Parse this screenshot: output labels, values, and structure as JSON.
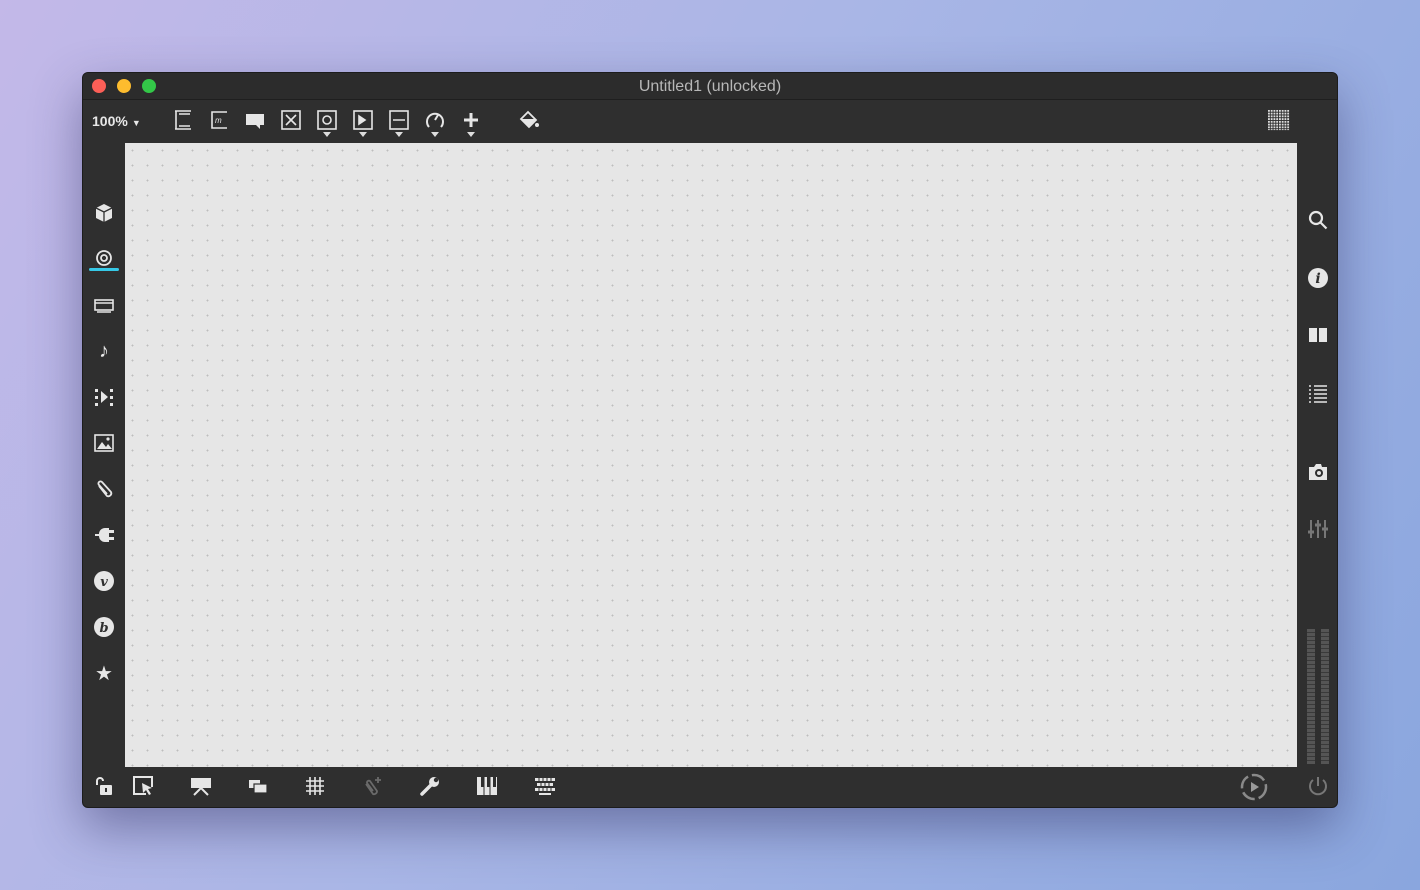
{
  "window": {
    "title": "Untitled1 (unlocked)"
  },
  "toolbar": {
    "zoom": "100%",
    "items": [
      {
        "name": "object-box",
        "dropdown": false
      },
      {
        "name": "message-box",
        "dropdown": false
      },
      {
        "name": "comment",
        "dropdown": false
      },
      {
        "name": "toggle",
        "dropdown": false
      },
      {
        "name": "button",
        "dropdown": true
      },
      {
        "name": "play",
        "dropdown": true
      },
      {
        "name": "slider",
        "dropdown": true
      },
      {
        "name": "dial",
        "dropdown": true
      },
      {
        "name": "add",
        "dropdown": true
      },
      {
        "name": "paint-bucket",
        "dropdown": false
      }
    ]
  },
  "left_sidebar": [
    "packages",
    "search-objects",
    "presentation",
    "audio",
    "media",
    "image",
    "clipping",
    "plugin",
    "vizzie",
    "beap",
    "favorites"
  ],
  "right_sidebar": [
    "search",
    "info",
    "reference",
    "list",
    "snapshot",
    "mixer"
  ],
  "bottom_bar": [
    "lock",
    "select",
    "presentation",
    "layers",
    "grid",
    "new-object-disabled",
    "tools",
    "keyboard-piano",
    "keyboard"
  ],
  "colors": {
    "close": "#fc5f57",
    "minimize": "#fdbc2e",
    "zoom": "#33c748",
    "accent": "#36c8e6"
  }
}
